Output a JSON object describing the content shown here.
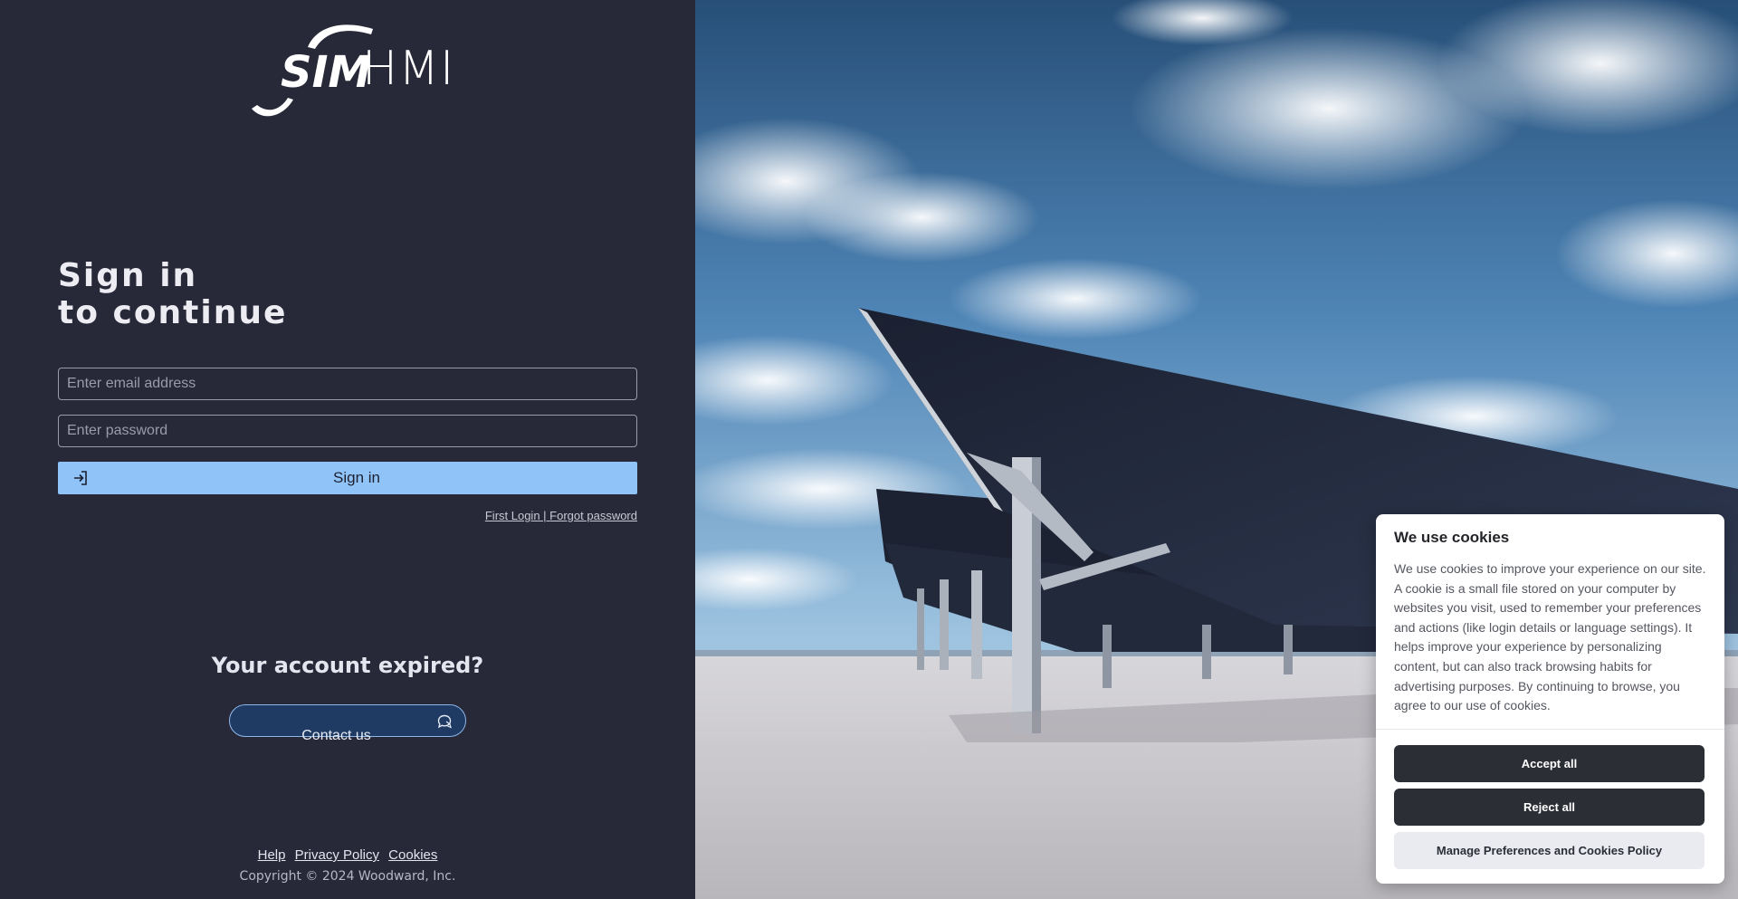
{
  "brand": {
    "logo_text": "SIM",
    "product": "HMI"
  },
  "login": {
    "heading_line1": "Sign in",
    "heading_line2": "to continue",
    "email_placeholder": "Enter email address",
    "password_placeholder": "Enter password",
    "signin_label": "Sign in",
    "first_login_label": "First Login",
    "separator": " | ",
    "forgot_password_label": "Forgot password"
  },
  "expired": {
    "heading": "Your account expired?",
    "contact_label": "Contact us"
  },
  "footer": {
    "links": [
      "Help",
      "Privacy Policy",
      "Cookies"
    ],
    "copyright": "Copyright © 2024 Woodward, Inc."
  },
  "cookie_banner": {
    "title": "We use cookies",
    "body": "We use cookies to improve your experience on our site. A cookie is a small file stored on your computer by websites you visit, used to remember your preferences and actions (like login details or language settings). It helps improve your experience by personalizing content, but can also track browsing habits for advertising purposes. By continuing to browse, you agree to our use of cookies.",
    "accept_label": "Accept all",
    "reject_label": "Reject all",
    "manage_label": "Manage Preferences and Cookies Policy"
  },
  "colors": {
    "panel_bg": "#272838",
    "signin_button": "#90c4f8",
    "contact_button": "#1f3a63",
    "cookie_button_dark": "#2b2e35"
  },
  "icons": {
    "signin": "sign-in-arrow-icon",
    "contact": "chat-bubble-icon"
  }
}
